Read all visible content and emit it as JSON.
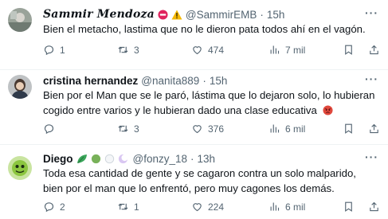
{
  "tweets": [
    {
      "name": "Sammir Mendoza",
      "handle": "@SammirEMB",
      "separator": "·",
      "time": "15h",
      "badges": [
        "no-entry-icon",
        "warning-icon"
      ],
      "text": "Bien el metacho, lastima que no le dieron pata todos ahí en el vagón.",
      "replies": "1",
      "retweets": "3",
      "likes": "474",
      "views": "7 mil"
    },
    {
      "name": "cristina hernandez",
      "handle": "@nanita889",
      "separator": "·",
      "time": "15h",
      "badges": [],
      "text": "Bien por el Man que se le paró, lástima que lo dejaron solo, lo hubieran cogido entre varios y le hubieran dado una clase educativa",
      "text_emoji": "angry-face-icon",
      "replies": "",
      "retweets": "3",
      "likes": "376",
      "views": "6 mil"
    },
    {
      "name": "Diego",
      "handle": "@fonzy_18",
      "separator": "·",
      "time": "13h",
      "badges": [
        "leaf-icon",
        "green-circle-icon",
        "white-circle-icon",
        "crescent-moon-icon"
      ],
      "text": "Toda esa cantidad de gente y se cagaron contra un solo malparido, bien por el man que lo enfrentó, pero muy cagones los demás.",
      "replies": "2",
      "retweets": "1",
      "likes": "224",
      "views": "6 mil"
    }
  ],
  "colors": {
    "text": "#0f1419",
    "muted": "#536471",
    "separator": "#eff3f4",
    "warning": "#f5b800",
    "no_entry": "#e0245e"
  }
}
